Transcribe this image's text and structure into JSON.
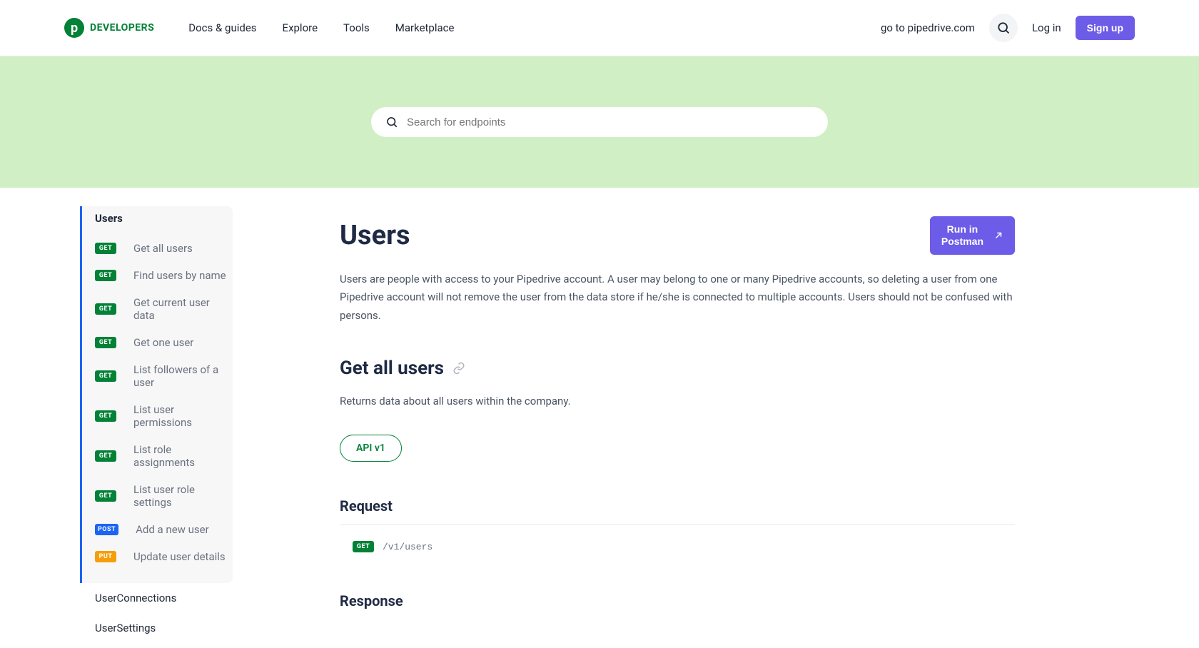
{
  "header": {
    "logo_letter": "p",
    "logo_text": "DEVELOPERS",
    "nav": [
      "Docs & guides",
      "Explore",
      "Tools",
      "Marketplace"
    ],
    "goto_link": "go to pipedrive.com",
    "login": "Log in",
    "signup": "Sign up"
  },
  "hero": {
    "search_placeholder": "Search for endpoints"
  },
  "sidebar": {
    "group_title": "Users",
    "items": [
      {
        "method": "GET",
        "label": "Get all users"
      },
      {
        "method": "GET",
        "label": "Find users by name"
      },
      {
        "method": "GET",
        "label": "Get current user data"
      },
      {
        "method": "GET",
        "label": "Get one user"
      },
      {
        "method": "GET",
        "label": "List followers of a user"
      },
      {
        "method": "GET",
        "label": "List user permissions"
      },
      {
        "method": "GET",
        "label": "List role assignments"
      },
      {
        "method": "GET",
        "label": "List user role settings"
      },
      {
        "method": "POST",
        "label": "Add a new user"
      },
      {
        "method": "PUT",
        "label": "Update user details"
      }
    ],
    "plain_items": [
      "UserConnections",
      "UserSettings"
    ]
  },
  "main": {
    "title": "Users",
    "postman_label": "Run in\nPostman",
    "description": "Users are people with access to your Pipedrive account. A user may belong to one or many Pipedrive accounts, so deleting a user from one Pipedrive account will not remove the user from the data store if he/she is connected to multiple accounts. Users should not be confused with persons.",
    "section_heading": "Get all users",
    "section_desc": "Returns data about all users within the company.",
    "api_version": "API v1",
    "request_heading": "Request",
    "endpoint_method": "GET",
    "endpoint_path": "/v1/users",
    "response_heading": "Response"
  }
}
